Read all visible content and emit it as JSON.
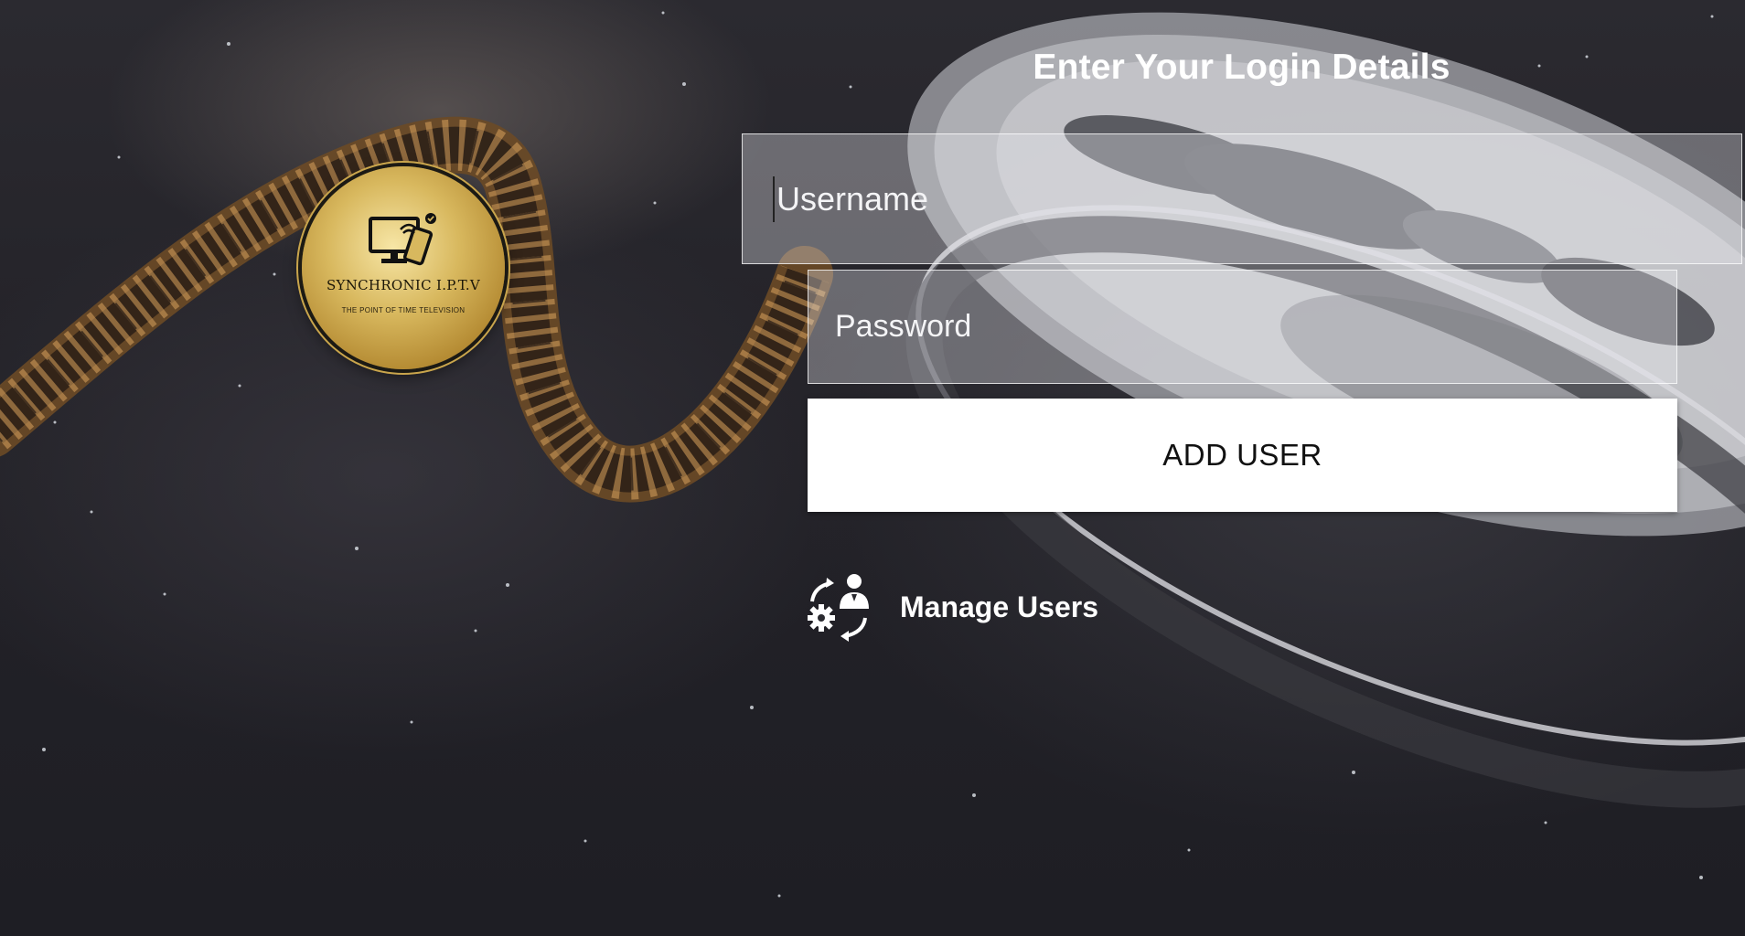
{
  "brand": {
    "name": "SYNCHRONIC I.P.T.V",
    "tagline": "THE POINT OF TIME TELEVISION",
    "logo_icon": "monitor-phone-icon",
    "gold": "#d8b85e"
  },
  "form": {
    "heading": "Enter Your Login Details",
    "username_placeholder": "Username",
    "password_placeholder": "Password",
    "submit_label": "ADD USER"
  },
  "manage_users": {
    "label": "Manage Users",
    "icon": "user-settings-icon"
  },
  "colors": {
    "text": "#ffffff",
    "button_bg": "#ffffff",
    "button_text": "#111111",
    "field_bg": "rgba(235,236,240,0.35)"
  }
}
